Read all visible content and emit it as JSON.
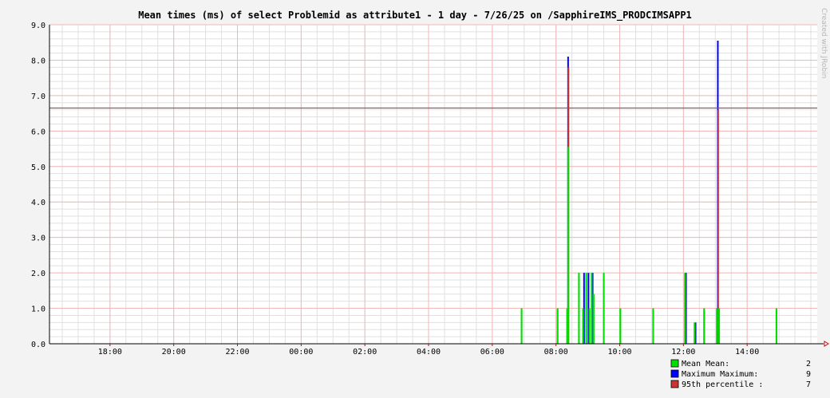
{
  "chart_data": {
    "type": "bar",
    "title": "Mean times (ms) of select Problemid as attribute1 - 1 day - 7/26/25 on /SapphireIMS_PRODCIMSAPP1",
    "watermark": "Created with JRobin",
    "xlabel": "",
    "ylabel": "",
    "x_ticks": [
      "18:00",
      "20:00",
      "22:00",
      "00:00",
      "02:00",
      "04:00",
      "06:00",
      "08:00",
      "10:00",
      "12:00",
      "14:00"
    ],
    "x_tick_hours": [
      18,
      20,
      22,
      24,
      26,
      28,
      30,
      32,
      34,
      36,
      38
    ],
    "xlim_hours": [
      16.1,
      40.2
    ],
    "y_ticks": [
      "0.0",
      "1.0",
      "2.0",
      "3.0",
      "4.0",
      "5.0",
      "6.0",
      "7.0",
      "8.0",
      "9.0"
    ],
    "ylim": [
      0,
      9
    ],
    "grid": true,
    "percentile_line": 6.65,
    "series": [
      {
        "name": "Mean",
        "color": "#00e000",
        "points": [
          {
            "x": 30.92,
            "y": 1
          },
          {
            "x": 32.05,
            "y": 1
          },
          {
            "x": 32.35,
            "y": 1
          },
          {
            "x": 32.38,
            "y": 5.55
          },
          {
            "x": 32.72,
            "y": 2
          },
          {
            "x": 32.85,
            "y": 1
          },
          {
            "x": 32.95,
            "y": 2
          },
          {
            "x": 33.05,
            "y": 1
          },
          {
            "x": 33.12,
            "y": 2
          },
          {
            "x": 33.18,
            "y": 1.4
          },
          {
            "x": 33.5,
            "y": 2
          },
          {
            "x": 34.02,
            "y": 1
          },
          {
            "x": 35.05,
            "y": 1
          },
          {
            "x": 36.05,
            "y": 2
          },
          {
            "x": 36.35,
            "y": 0.6
          },
          {
            "x": 36.65,
            "y": 1
          },
          {
            "x": 37.05,
            "y": 1
          },
          {
            "x": 37.12,
            "y": 1
          },
          {
            "x": 38.92,
            "y": 1
          }
        ]
      },
      {
        "name": "Maximum",
        "color": "#0000ff",
        "points": [
          {
            "x": 32.38,
            "y": 8.1
          },
          {
            "x": 32.88,
            "y": 2
          },
          {
            "x": 33.02,
            "y": 2
          },
          {
            "x": 33.15,
            "y": 2
          },
          {
            "x": 36.08,
            "y": 2
          },
          {
            "x": 36.38,
            "y": 0.6
          },
          {
            "x": 37.08,
            "y": 8.55
          }
        ]
      },
      {
        "name": "95th percentile",
        "color": "#cc3333",
        "points": [
          {
            "x": 32.39,
            "y": 7.8
          },
          {
            "x": 37.09,
            "y": 6.6
          }
        ]
      }
    ],
    "legend": [
      {
        "label": "Mean  Mean:",
        "value": "2",
        "color": "#00e000"
      },
      {
        "label": "Maximum  Maximum:",
        "value": "9",
        "color": "#0000ff"
      },
      {
        "label": "95th percentile  :",
        "value": "7",
        "color": "#cc3333"
      }
    ]
  }
}
